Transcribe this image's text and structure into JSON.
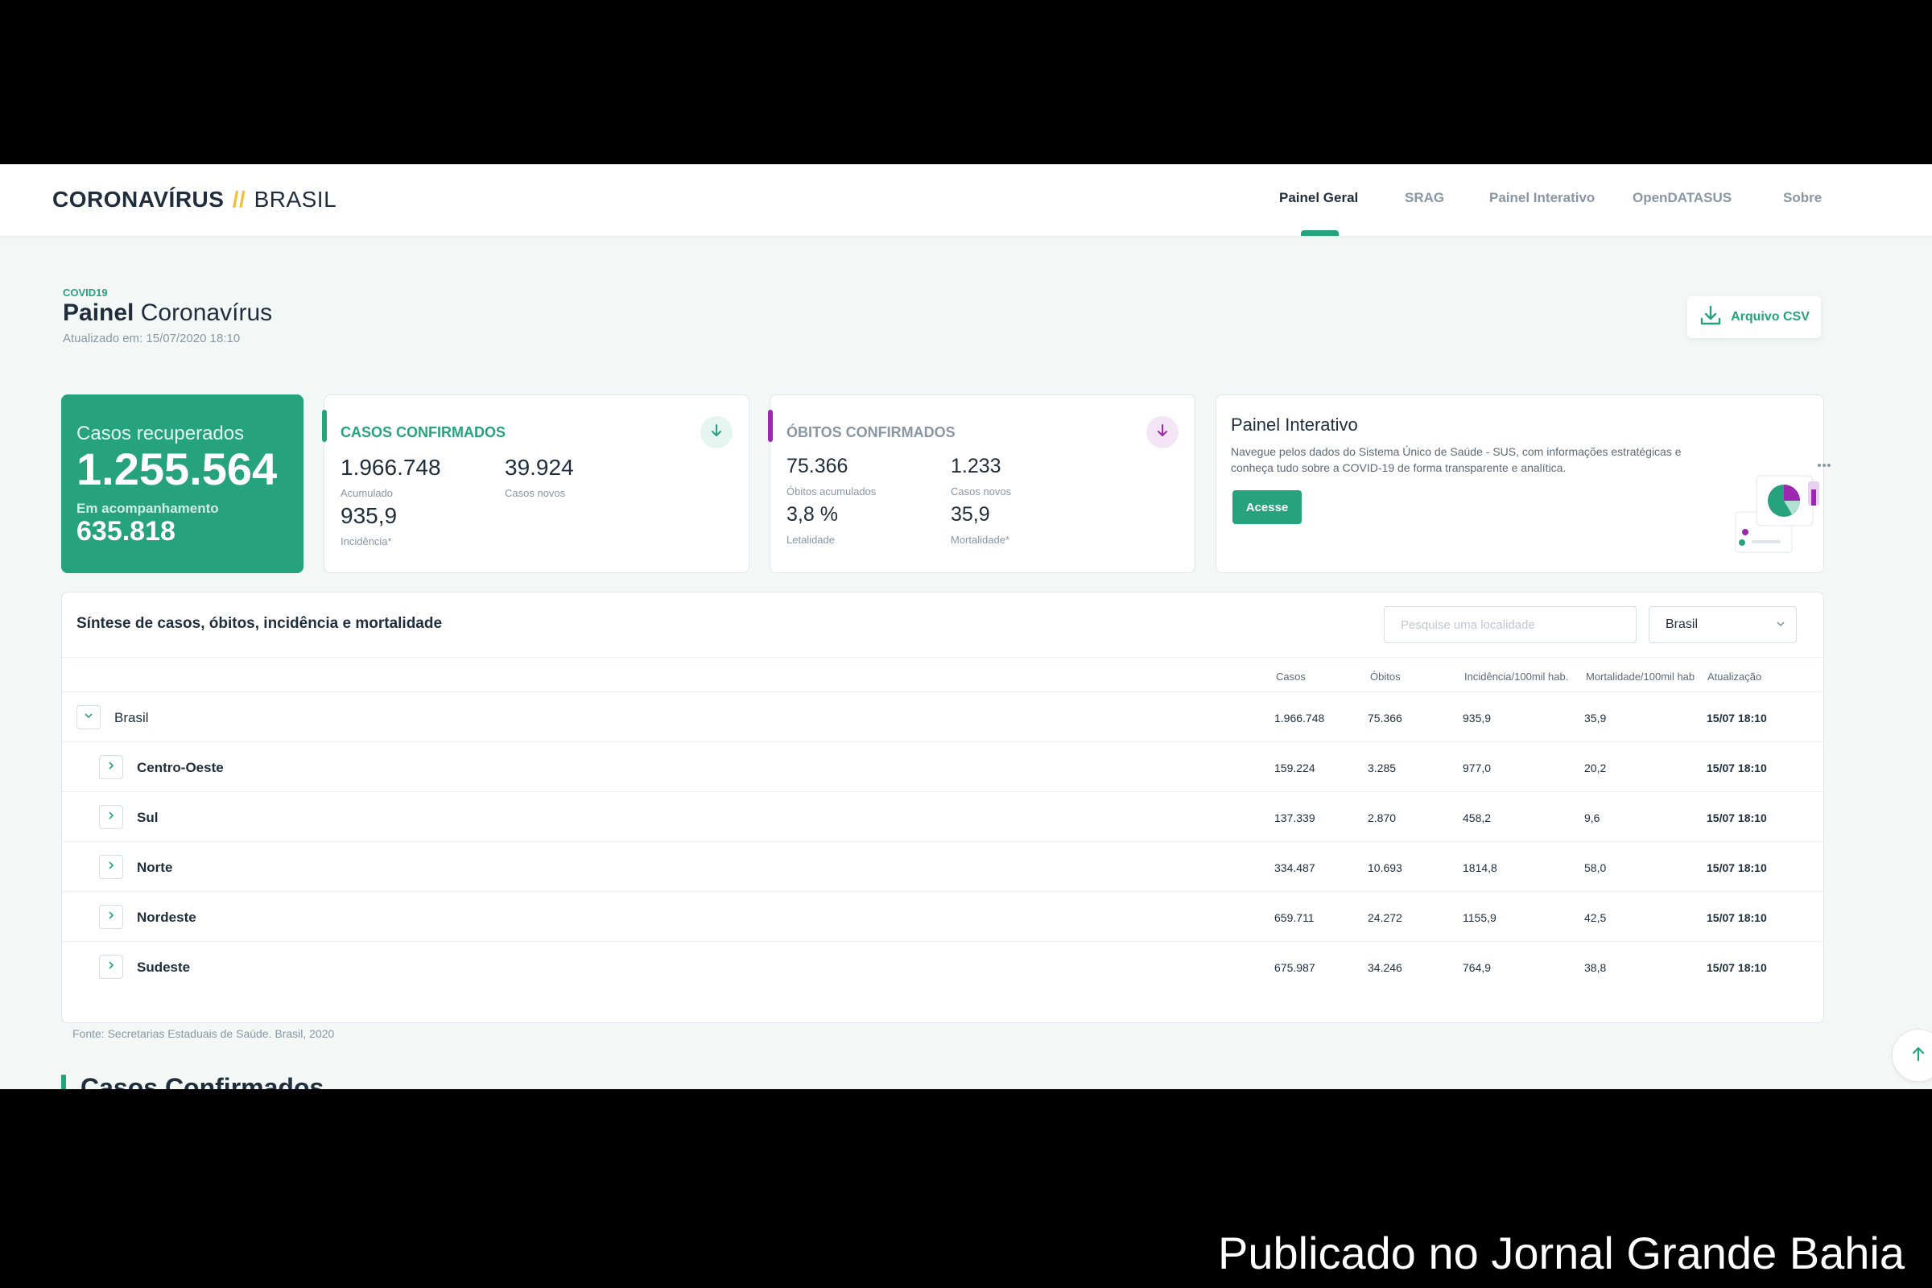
{
  "header": {
    "brand_main": "CORONAVÍRUS",
    "brand_sep": "//",
    "brand_sub": "BRASIL",
    "nav": [
      "Painel Geral",
      "SRAG",
      "Painel Interativo",
      "OpenDATASUS",
      "Sobre"
    ],
    "active_nav": "Painel Geral"
  },
  "page": {
    "label": "COVID19",
    "title_bold": "Painel",
    "title_rest": "Coronavírus",
    "updated": "Atualizado em:  15/07/2020 18:10",
    "csv_label": "Arquivo CSV"
  },
  "cards": {
    "recovered": {
      "title": "Casos recuperados",
      "value": "1.255.564",
      "sub_label": "Em acompanhamento",
      "sub_value": "635.818"
    },
    "confirmed": {
      "title": "CASOS CONFIRMADOS",
      "accumulated": "1.966.748",
      "accumulated_label": "Acumulado",
      "new": "39.924",
      "new_label": "Casos novos",
      "incidence": "935,9",
      "incidence_label": "Incidência*"
    },
    "deaths": {
      "title": "ÓBITOS CONFIRMADOS",
      "accumulated": "75.366",
      "accumulated_label": "Óbitos acumulados",
      "new": "1.233",
      "new_label": "Casos novos",
      "lethality": "3,8 %",
      "lethality_label": "Letalidade",
      "mortality": "35,9",
      "mortality_label": "Mortalidade*"
    },
    "interactive": {
      "title": "Painel Interativo",
      "desc": "Navegue pelos dados do Sistema Único de Saúde - SUS, com informações estratégicas e conheça tudo sobre a COVID-19 de forma transparente e analítica.",
      "button": "Acesse"
    }
  },
  "table": {
    "title": "Síntese de casos, óbitos, incidência e mortalidade",
    "search_placeholder": "Pesquise uma localidade",
    "select_value": "Brasil",
    "columns": [
      "Casos",
      "Óbitos",
      "Incidência/100mil hab.",
      "Mortalidade/100mil hab",
      "Atualização"
    ],
    "rows": [
      {
        "name": "Brasil",
        "casos": "1.966.748",
        "obitos": "75.366",
        "incidencia": "935,9",
        "mortalidade": "35,9",
        "atualizacao": "15/07 18:10",
        "expanded": true
      },
      {
        "name": "Centro-Oeste",
        "casos": "159.224",
        "obitos": "3.285",
        "incidencia": "977,0",
        "mortalidade": "20,2",
        "atualizacao": "15/07 18:10",
        "expanded": false
      },
      {
        "name": "Sul",
        "casos": "137.339",
        "obitos": "2.870",
        "incidencia": "458,2",
        "mortalidade": "9,6",
        "atualizacao": "15/07 18:10",
        "expanded": false
      },
      {
        "name": "Norte",
        "casos": "334.487",
        "obitos": "10.693",
        "incidencia": "1814,8",
        "mortalidade": "58,0",
        "atualizacao": "15/07 18:10",
        "expanded": false
      },
      {
        "name": "Nordeste",
        "casos": "659.711",
        "obitos": "24.272",
        "incidencia": "1155,9",
        "mortalidade": "42,5",
        "atualizacao": "15/07 18:10",
        "expanded": false
      },
      {
        "name": "Sudeste",
        "casos": "675.987",
        "obitos": "34.246",
        "incidencia": "764,9",
        "mortalidade": "38,8",
        "atualizacao": "15/07 18:10",
        "expanded": false
      }
    ],
    "source": "Fonte: Secretarias Estaduais de Saúde. Brasil, 2020"
  },
  "next_section": "Casos Confirmados",
  "watermark": "Publicado no Jornal Grande Bahia",
  "colors": {
    "accent": "#26a37d",
    "deaths_accent": "#9c27b0",
    "brand_slash": "#f2c037"
  },
  "icons": {
    "download": "download-icon",
    "arrow_down": "arrow-down-icon",
    "chevron": "chevron-icon",
    "arrow_up": "arrow-up-icon"
  }
}
